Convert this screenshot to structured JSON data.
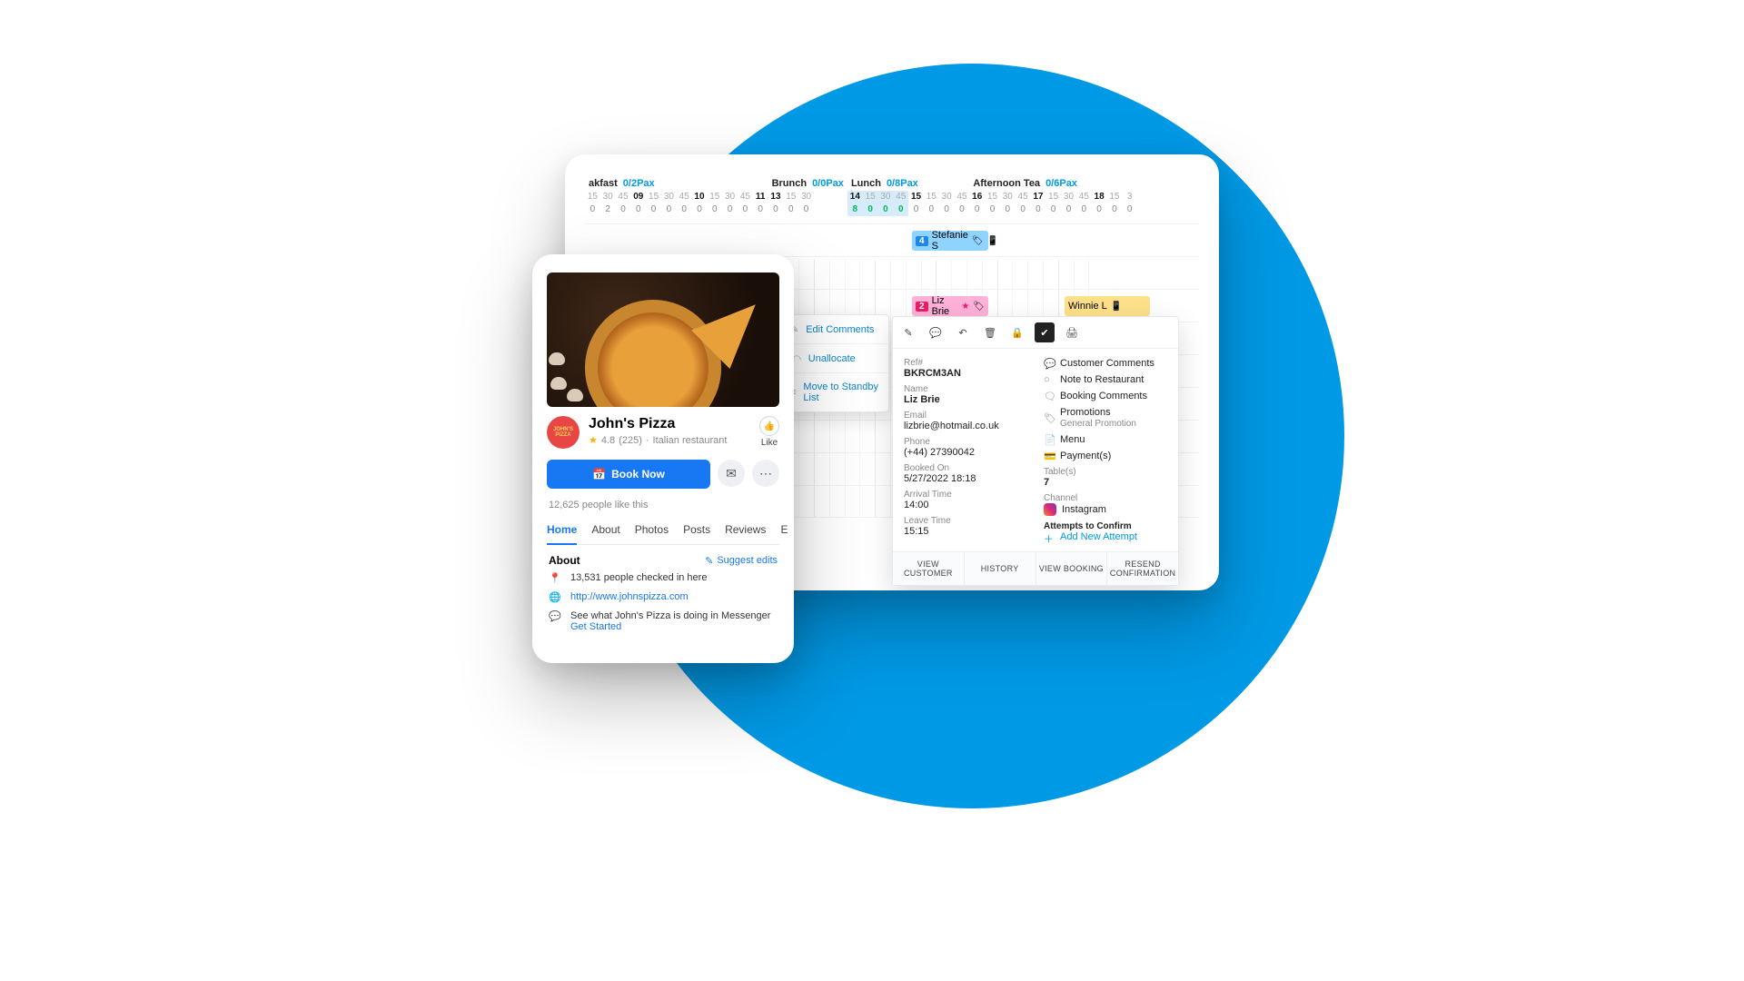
{
  "scheduler": {
    "periods": [
      {
        "name": "akfast",
        "pax": "0/2Pax",
        "ticks": [
          "15",
          "30",
          "45",
          "09",
          "15",
          "30",
          "45",
          "10",
          "15",
          "30",
          "45",
          "11"
        ],
        "bold": [
          3,
          7,
          11
        ],
        "counts": [
          "0",
          "2",
          "0",
          "0",
          "0",
          "0",
          "0",
          "0",
          "0",
          "0",
          "0",
          "0"
        ]
      },
      {
        "name": "Brunch",
        "pax": "0/0Pax",
        "ticks": [
          "13",
          "15",
          "30"
        ],
        "bold": [
          0
        ],
        "counts": [
          "0",
          "0",
          "0"
        ]
      },
      {
        "name": "Lunch",
        "pax": "0/8Pax",
        "ticks": [
          "14",
          "15",
          "30",
          "45",
          "15",
          "15",
          "30",
          "45"
        ],
        "bold": [
          0,
          4
        ],
        "blue": [
          0,
          1,
          2,
          3
        ],
        "counts": [
          "8",
          "0",
          "0",
          "0",
          "0",
          "0",
          "0",
          "0"
        ]
      },
      {
        "name": "Afternoon Tea",
        "pax": "0/6Pax",
        "ticks": [
          "16",
          "15",
          "30",
          "45",
          "17",
          "15",
          "30",
          "45",
          "18",
          "15",
          "3"
        ],
        "bold": [
          0,
          4,
          8
        ],
        "counts": [
          "0",
          "0",
          "0",
          "0",
          "0",
          "0",
          "0",
          "0",
          "0",
          "0",
          "0"
        ]
      }
    ],
    "context": [
      {
        "icon": "edit",
        "label": "Edit Comments"
      },
      {
        "icon": "unalloc",
        "label": "Unallocate"
      },
      {
        "icon": "standby",
        "label": "Move to Standby List"
      }
    ],
    "bookings": {
      "b1": {
        "count": "4",
        "name": "Stefanie S"
      },
      "b2": {
        "count": "2",
        "name": "Liz Brie"
      },
      "b3": {
        "count": "",
        "name": "Winnie L"
      }
    },
    "tooltip": {
      "ref_lbl": "Ref#",
      "ref": "BKRCM3AN",
      "name_lbl": "Name",
      "name": "Liz Brie",
      "email_lbl": "Email",
      "email": "lizbrie@hotmail.co.uk",
      "phone_lbl": "Phone",
      "phone": "(+44) 27390042",
      "booked_lbl": "Booked On",
      "booked": "5/27/2022 18:18",
      "arr_lbl": "Arrival Time",
      "arr": "14:00",
      "leave_lbl": "Leave Time",
      "leave": "15:15",
      "right": [
        {
          "icon": "💬",
          "label": "Customer Comments"
        },
        {
          "icon": "○",
          "label": "Note to Restaurant"
        },
        {
          "icon": "🗨",
          "label": "Booking Comments"
        },
        {
          "icon": "🏷",
          "label": "Promotions",
          "sub": "General Promotion"
        },
        {
          "icon": "📄",
          "label": "Menu"
        },
        {
          "icon": "💳",
          "label": "Payment(s)"
        }
      ],
      "table_lbl": "Table(s)",
      "table": "7",
      "channel_lbl": "Channel",
      "channel": "Instagram",
      "attempts": "Attempts to Confirm",
      "addattempt": "Add New Attempt",
      "buttons": [
        "VIEW CUSTOMER",
        "HISTORY",
        "VIEW BOOKING",
        "RESEND CONFIRMATION"
      ]
    }
  },
  "fb": {
    "name": "John's Pizza",
    "rating": "4.8",
    "reviews": "(225)",
    "category": "Italian restaurant",
    "like": "Like",
    "book": "Book Now",
    "likes": "12,625 people like this",
    "tabs": [
      "Home",
      "About",
      "Photos",
      "Posts",
      "Reviews",
      "E"
    ],
    "about": "About",
    "suggest": "Suggest edits",
    "checkin": "13,531 people checked in here",
    "url": "http://www.johnspizza.com",
    "messenger": "See what John's Pizza is doing in Messenger",
    "getstarted": "Get Started",
    "logo": "JOHN'S PIZZA"
  }
}
